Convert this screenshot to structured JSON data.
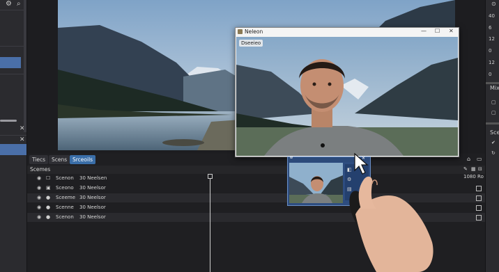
{
  "right_panel": {
    "values": [
      "40",
      "6",
      "12",
      "0",
      "12",
      "0"
    ],
    "mixer_label": "Mix",
    "scenes_label": "Sce"
  },
  "dock": {
    "tabs": [
      {
        "label": "Tiecs",
        "active": false
      },
      {
        "label": "Scens",
        "active": false
      },
      {
        "label": "Srceoils",
        "active": true
      }
    ],
    "scenes_header": "Scemes",
    "header_right_value": "1080 Ro",
    "rows": [
      {
        "name": "Scenon",
        "res": "30 Neelsen"
      },
      {
        "name": "Sceono",
        "res": "30 Neelsor"
      },
      {
        "name": "Sceeme",
        "res": "30 Neelsor"
      },
      {
        "name": "Scenne",
        "res": "30 Neelsor"
      },
      {
        "name": "Scenon",
        "res": "30 Neelsor"
      }
    ]
  },
  "webcam_window": {
    "title": "Neleon",
    "source_label": "Dseeieo",
    "colors": {
      "titlebar": "#f4f4f4",
      "accent": "#3a6ea8"
    }
  },
  "mini_window": {
    "title": "w"
  }
}
